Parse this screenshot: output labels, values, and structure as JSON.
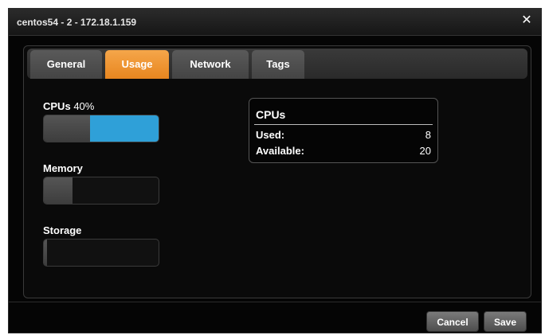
{
  "window": {
    "title": "centos54 - 2 - 172.18.1.159"
  },
  "tabs": [
    {
      "label": "General",
      "active": false
    },
    {
      "label": "Usage",
      "active": true
    },
    {
      "label": "Network",
      "active": false
    },
    {
      "label": "Tags",
      "active": false
    }
  ],
  "usage": {
    "cpu": {
      "label": "CPUs",
      "percent_text": "40%",
      "used_fraction": 0.6,
      "fill_color": "#2fa0d8"
    },
    "memory": {
      "label": "Memory",
      "used_fraction": 0.25
    },
    "storage": {
      "label": "Storage",
      "used_fraction": 0.03
    }
  },
  "cpu_info": {
    "title": "CPUs",
    "rows": [
      {
        "key": "Used:",
        "value": "8"
      },
      {
        "key": "Available:",
        "value": "20"
      }
    ]
  },
  "footer": {
    "cancel_label": "Cancel",
    "save_label": "Save"
  },
  "colors": {
    "accent_tab": "#f0962e",
    "cpu_bar": "#2fa0d8"
  },
  "icons": {
    "close": "close-icon"
  }
}
